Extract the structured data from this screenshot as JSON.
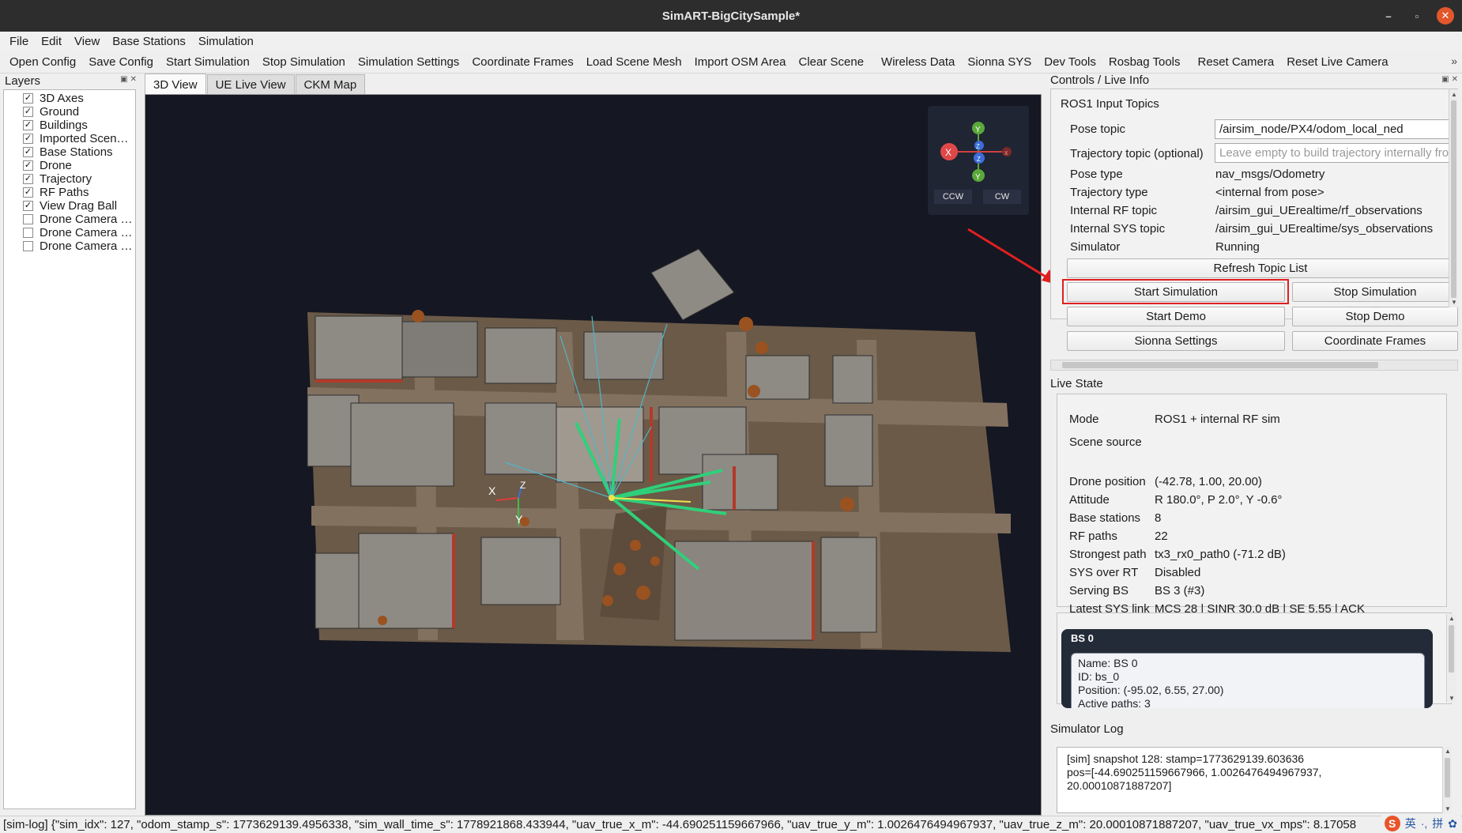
{
  "window": {
    "title": "SimART-BigCitySample*",
    "minimize": "–",
    "restore": "▫",
    "close": "✕"
  },
  "menu": [
    "File",
    "Edit",
    "View",
    "Base Stations",
    "Simulation"
  ],
  "toolbar": [
    "Open Config",
    "Save Config",
    "Start Simulation",
    "Stop Simulation",
    "Simulation Settings",
    "Coordinate Frames",
    "Load Scene Mesh",
    "Import OSM Area",
    "Clear Scene",
    "Wireless Data",
    "Sionna SYS",
    "Dev Tools",
    "Rosbag Tools",
    "Reset Camera",
    "Reset Live Camera"
  ],
  "toolbar_more": "»",
  "layers": {
    "title": "Layers",
    "items": [
      {
        "label": "3D Axes",
        "checked": true
      },
      {
        "label": "Ground",
        "checked": true
      },
      {
        "label": "Buildings",
        "checked": true
      },
      {
        "label": "Imported Scen…",
        "checked": true
      },
      {
        "label": "Base Stations",
        "checked": true
      },
      {
        "label": "Drone",
        "checked": true
      },
      {
        "label": "Trajectory",
        "checked": true
      },
      {
        "label": "RF Paths",
        "checked": true
      },
      {
        "label": "View Drag Ball",
        "checked": true
      },
      {
        "label": "Drone Camera …",
        "checked": false
      },
      {
        "label": "Drone Camera …",
        "checked": false
      },
      {
        "label": "Drone Camera …",
        "checked": false
      }
    ]
  },
  "tabs": [
    {
      "label": "3D View",
      "active": true
    },
    {
      "label": "UE Live View",
      "active": false
    },
    {
      "label": "CKM Map",
      "active": false
    }
  ],
  "gizmo": {
    "x": "X",
    "y": "Y",
    "z": "Z",
    "neg_x": "x",
    "ccw": "CCW",
    "cw": "CW"
  },
  "scene_axes": {
    "x": "X",
    "y": "Y",
    "z": "Z"
  },
  "controls": {
    "title": "Controls / Live Info",
    "group_title": "ROS1 Input Topics",
    "pose_topic_label": "Pose topic",
    "pose_topic_value": "/airsim_node/PX4/odom_local_ned",
    "trajectory_topic_label": "Trajectory topic (optional)",
    "trajectory_topic_placeholder": "Leave empty to build trajectory internally from pose",
    "rows": [
      {
        "k": "Pose type",
        "v": "nav_msgs/Odometry"
      },
      {
        "k": "Trajectory type",
        "v": "<internal from pose>"
      },
      {
        "k": "Internal RF topic",
        "v": "/airsim_gui_UErealtime/rf_observations"
      },
      {
        "k": "Internal SYS topic",
        "v": "/airsim_gui_UErealtime/sys_observations"
      },
      {
        "k": "Simulator",
        "v": "Running"
      }
    ],
    "refresh_button": "Refresh Topic List",
    "start_sim": "Start Simulation",
    "stop_sim": "Stop Simulation",
    "start_demo": "Start Demo",
    "stop_demo": "Stop Demo",
    "sionna_settings": "Sionna Settings",
    "coordinate_frames": "Coordinate Frames"
  },
  "live_state": {
    "title": "Live State",
    "rows": [
      {
        "k": "Mode",
        "v": "ROS1 + internal RF sim"
      },
      {
        "k": "Scene source",
        "v": ""
      },
      {
        "k": "Drone position",
        "v": "(-42.78, 1.00, 20.00)"
      },
      {
        "k": "Attitude",
        "v": "R 180.0°, P 2.0°, Y -0.6°"
      },
      {
        "k": "Base stations",
        "v": "8"
      },
      {
        "k": "RF paths",
        "v": "22"
      },
      {
        "k": "Strongest path",
        "v": "tx3_rx0_path0 (-71.2 dB)"
      },
      {
        "k": "SYS over RT",
        "v": "Disabled"
      },
      {
        "k": "Serving BS",
        "v": "BS 3 (#3)"
      },
      {
        "k": "Latest SYS link",
        "v": "MCS 28 | SINR 30.0 dB | SE 5.55 | ACK"
      }
    ],
    "bs_card": {
      "header": "BS 0",
      "lines": [
        "Name: BS 0",
        "ID: bs_0",
        "Position: (-95.02, 6.55, 27.00)",
        "Active paths: 3"
      ]
    }
  },
  "sim_log": {
    "title": "Simulator Log",
    "lines": [
      "[sim] snapshot 128: stamp=1773629139.603636",
      "pos=[-44.690251159667966, 1.0026476494967937,",
      "20.00010871887207]"
    ]
  },
  "status_bar": "[sim-log] {\"sim_idx\": 127, \"odom_stamp_s\": 1773629139.4956338, \"sim_wall_time_s\": 1778921868.433944, \"uav_true_x_m\": -44.690251159667966, \"uav_true_y_m\": 1.0026476494967937, \"uav_true_z_m\": 20.00010871887207, \"uav_true_vx_mps\": 8.17058",
  "tray": {
    "s": "S",
    "lang": "英",
    "dot": "·,",
    "ime": "拼",
    "settings": "✿"
  },
  "colors": {
    "viewport_bg": "#151722",
    "highlight": "#e02020",
    "rf_path": "#2fd07a",
    "ground": "#6b5a48"
  }
}
